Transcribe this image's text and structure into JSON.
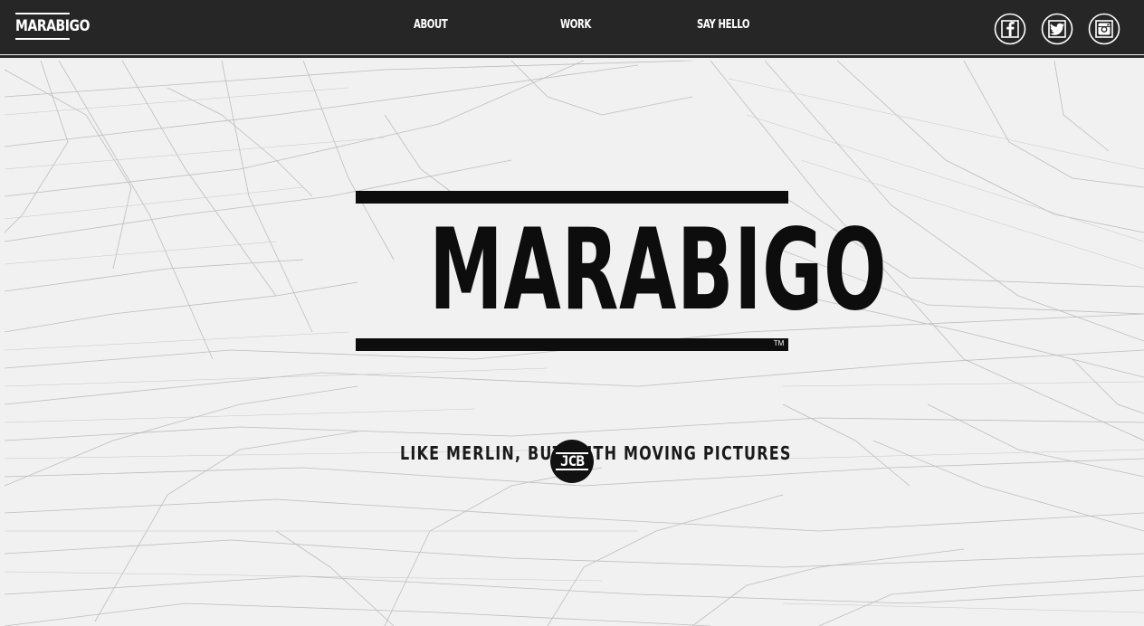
{
  "header": {
    "logo_text": "MARABIGO",
    "nav": [
      {
        "label": "ABOUT"
      },
      {
        "label": "WORK"
      },
      {
        "label": "SAY HELLO"
      }
    ],
    "social_icons": [
      "facebook-icon",
      "twitter-icon",
      "instagram-icon"
    ]
  },
  "hero": {
    "title": "MARABIGO",
    "trademark": "TM",
    "tagline": "LIKE MERLIN, BUT WITH MOVING PICTURES",
    "badge_text": "JCB"
  },
  "colors": {
    "header_bg": "#262626",
    "page_bg": "#f1f1f1",
    "ink": "#0d0d0d",
    "line_gray": "#bdbdbd"
  }
}
